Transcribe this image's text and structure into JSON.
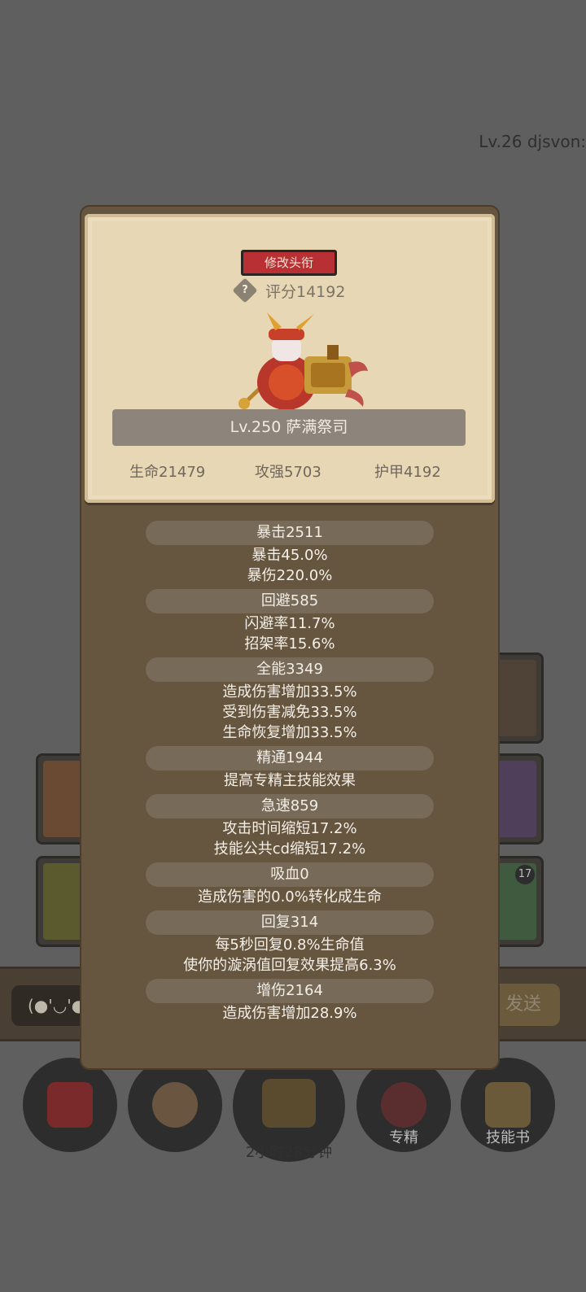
{
  "background": {
    "player_tag": "Lv.26 djsvon:",
    "chat_placeholder": "(●'◡'●",
    "send_label": "发送",
    "slot_badge": "17",
    "timer_text": "2小时28分钟",
    "dock_labels": [
      "专精",
      "技能书"
    ]
  },
  "popup": {
    "change_title_button": "修改头衔",
    "help_icon": "?",
    "score": "评分14192",
    "hero_name": "Lv.250 萨满祭司",
    "base_stats": [
      "生命21479",
      "攻强5703",
      "护甲4192"
    ],
    "stat_groups": [
      {
        "header": "暴击2511",
        "lines": [
          "暴击45.0%",
          "暴伤220.0%"
        ]
      },
      {
        "header": "回避585",
        "lines": [
          "闪避率11.7%",
          "招架率15.6%"
        ]
      },
      {
        "header": "全能3349",
        "lines": [
          "造成伤害增加33.5%",
          "受到伤害减免33.5%",
          "生命恢复增加33.5%"
        ]
      },
      {
        "header": "精通1944",
        "lines": [
          "提高专精主技能效果"
        ]
      },
      {
        "header": "急速859",
        "lines": [
          "攻击时间缩短17.2%",
          "技能公共cd缩短17.2%"
        ]
      },
      {
        "header": "吸血0",
        "lines": [
          "造成伤害的0.0%转化成生命"
        ]
      },
      {
        "header": "回复314",
        "lines": [
          "每5秒回复0.8%生命值",
          "使你的漩涡值回复效果提高6.3%"
        ]
      },
      {
        "header": "增伤2164",
        "lines": [
          "造成伤害增加28.9%"
        ]
      }
    ]
  },
  "colors": {
    "accent_button": "#b83034",
    "panel_brown": "#66553f",
    "card_parchment": "#e8d7b4"
  }
}
